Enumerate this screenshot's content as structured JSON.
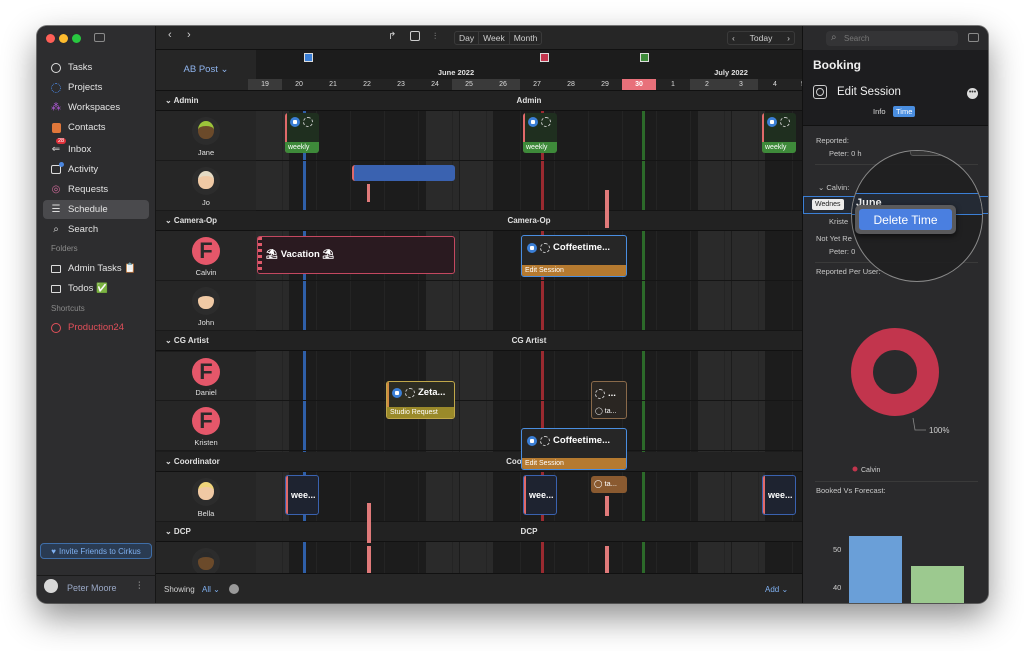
{
  "sidebar": {
    "items": [
      {
        "label": "Tasks",
        "icon": "circle-icon"
      },
      {
        "label": "Projects",
        "icon": "projects-icon"
      },
      {
        "label": "Workspaces",
        "icon": "workspaces-icon"
      },
      {
        "label": "Contacts",
        "icon": "contacts-icon"
      },
      {
        "label": "Inbox",
        "icon": "inbox-icon",
        "badge": "28"
      },
      {
        "label": "Activity",
        "icon": "activity-icon"
      },
      {
        "label": "Requests",
        "icon": "requests-icon"
      },
      {
        "label": "Schedule",
        "icon": "schedule-icon"
      },
      {
        "label": "Search",
        "icon": "search-icon"
      }
    ],
    "folders_label": "Folders",
    "folders": [
      {
        "label": "Admin Tasks 📋"
      },
      {
        "label": "Todos ✅"
      }
    ],
    "shortcuts_label": "Shortcuts",
    "shortcuts": [
      {
        "label": "Production24"
      }
    ],
    "invite_label": "Invite Friends to Cirkus",
    "user_name": "Peter Moore"
  },
  "toolbar": {
    "day": "Day",
    "week": "Week",
    "month": "Month",
    "today": "Today"
  },
  "schedule": {
    "title": "AB Post",
    "months": [
      "June 2022",
      "July 2022"
    ],
    "days": [
      "19",
      "20",
      "21",
      "22",
      "23",
      "24",
      "25",
      "26",
      "27",
      "28",
      "29",
      "30",
      "1",
      "2",
      "3",
      "4",
      "5"
    ],
    "groups": [
      "Admin",
      "Camera-Op",
      "CG Artist",
      "Coordinator",
      "DCP"
    ],
    "people": [
      "Jane",
      "Jo",
      "Calvin",
      "John",
      "Daniel",
      "Kristen",
      "Bella"
    ],
    "events": {
      "weekly": "weekly",
      "vacation": "Vacation",
      "coffeetime": "Coffeetime...",
      "edit_session": "Edit Session",
      "zeta": "Zeta...",
      "studio_request": "Studio Request",
      "ta": "ta...",
      "ellipsis": "...",
      "wee": "wee..."
    },
    "showing_label": "Showing",
    "showing_value": "All",
    "add_label": "Add"
  },
  "panel": {
    "search_placeholder": "Search",
    "title": "Booking",
    "subtitle": "Edit Session",
    "tab_info": "Info",
    "tab_time": "Time",
    "reported": "Reported:",
    "reported_person": "Peter: 0 h",
    "calvin": "Calvin:",
    "day_row": "Wednes",
    "june": "June",
    "row_count": "1",
    "kriste": "Kriste",
    "not_yet": "Not Yet Re",
    "peter_0": "Peter: 0",
    "reported_per_user": "Reported Per User:",
    "delete_time": "Delete Time",
    "donut_label": "100%",
    "legend": "Calvin",
    "booked_vs_forecast": "Booked Vs Forecast:",
    "axis_50": "50",
    "axis_40": "40"
  },
  "chart_data": {
    "type": "pie",
    "title": "Reported Per User:",
    "slices": [
      {
        "label": "Calvin",
        "value": 100
      }
    ]
  },
  "colors": {
    "accent": "#3b82d6",
    "donut": "#c2354d",
    "bar_blue": "#6a9fd8",
    "bar_green": "#9cc98f"
  }
}
